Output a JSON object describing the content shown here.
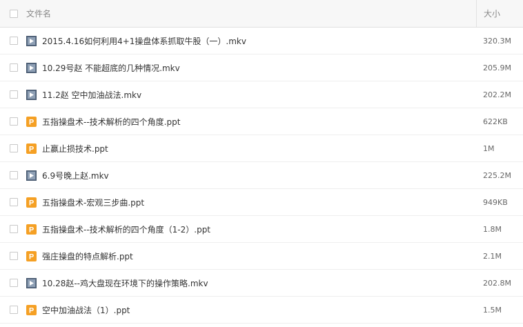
{
  "header": {
    "name_label": "文件名",
    "size_label": "大小"
  },
  "icons": {
    "video": "video-file-icon",
    "ppt": "ppt-file-icon"
  },
  "colors": {
    "video_icon": "#5a6d86",
    "ppt_icon": "#f5a024"
  },
  "files": [
    {
      "name": "2015.4.16如何利用4+1操盘体系抓取牛股（一）.mkv",
      "size": "320.3M",
      "type": "video"
    },
    {
      "name": "10.29号赵 不能超底的几种情况.mkv",
      "size": "205.9M",
      "type": "video"
    },
    {
      "name": "11.2赵 空中加油战法.mkv",
      "size": "202.2M",
      "type": "video"
    },
    {
      "name": "五指操盘术--技术解析的四个角度.ppt",
      "size": "622KB",
      "type": "ppt"
    },
    {
      "name": "止赢止损技术.ppt",
      "size": "1M",
      "type": "ppt"
    },
    {
      "name": "6.9号晚上赵.mkv",
      "size": "225.2M",
      "type": "video"
    },
    {
      "name": "五指操盘术-宏观三步曲.ppt",
      "size": "949KB",
      "type": "ppt"
    },
    {
      "name": "五指操盘术--技术解析的四个角度（1-2）.ppt",
      "size": "1.8M",
      "type": "ppt"
    },
    {
      "name": "强庄操盘的特点解析.ppt",
      "size": "2.1M",
      "type": "ppt"
    },
    {
      "name": "10.28赵--鸡大盘现在环境下的操作策略.mkv",
      "size": "202.8M",
      "type": "video"
    },
    {
      "name": "空中加油战法（1）.ppt",
      "size": "1.5M",
      "type": "ppt"
    }
  ]
}
